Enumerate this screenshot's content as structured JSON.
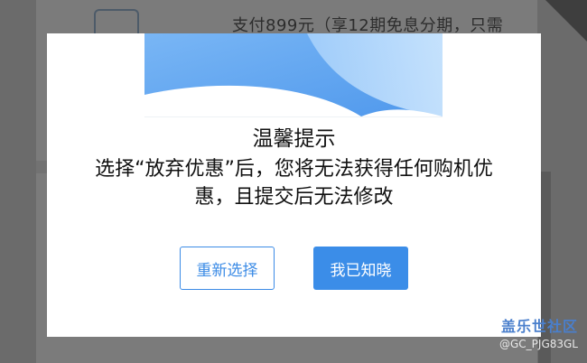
{
  "background": {
    "payment_text": "支付899元（享12期免息分期，只需",
    "watermark_logo": "盖乐世社区",
    "watermark_user": "@GC_PJG83GL"
  },
  "dialog": {
    "title": "温馨提示",
    "message_line1": "选择“放弃优惠”后，您将无法获得任何购机优",
    "message_line2": "惠，且提交后无法修改",
    "reselect_label": "重新选择",
    "acknowledge_label": "我已知晓"
  },
  "colors": {
    "accent": "#3b8de8",
    "overlay": "#6b6b6b",
    "banner_light": "#bfe0ff",
    "banner_mid": "#8fc3f7",
    "banner_dark": "#5aa0ee"
  }
}
